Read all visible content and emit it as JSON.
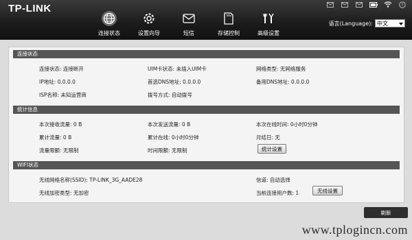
{
  "brand": {
    "logo": "TP-LINK"
  },
  "status_bar_icons": [
    "sms-icon",
    "sms-icon",
    "mail-icon",
    "battery-icon",
    "wifi-icon",
    "help-icon"
  ],
  "nav": {
    "items": [
      {
        "label": "连接状态",
        "icon": "globe-icon",
        "active": true
      },
      {
        "label": "设置向导",
        "icon": "gear-icon",
        "active": false
      },
      {
        "label": "短信",
        "icon": "envelope-icon",
        "active": false
      },
      {
        "label": "存储控制",
        "icon": "sd-card-icon",
        "active": false
      },
      {
        "label": "高级设置",
        "icon": "tools-icon",
        "active": false
      }
    ]
  },
  "language": {
    "label": "语言(Language):",
    "selected": "中文"
  },
  "connection": {
    "header": "连接状态",
    "conn_status": "连接状态: 连接断开",
    "uim_status": "UIM卡状态: 未插入UIM卡",
    "network_type": "网络类型: 无网络服务",
    "ip": "IP地址: 0.0.0.0",
    "dns1": "首选DNS地址: 0.0.0.0",
    "dns2": "备用DNS地址: 0.0.0.0",
    "isp": "ISP名称: 未知运营商",
    "dial_mode": "拨号方式: 自动拨号"
  },
  "stats": {
    "header": "统计信息",
    "rx": "本次接收流量: 0 B",
    "tx": "本次发送流量: 0 B",
    "online_time": "本次在线时间: 0小时0分钟",
    "total_traffic": "累计流量: 0 B",
    "total_online": "累计在线: 0小时0分钟",
    "month_end": "月结日: 无",
    "traffic_limit": "流量限额: 无限制",
    "time_limit": "时间限额: 无限制",
    "stats_button": "统计设置"
  },
  "wifi": {
    "header": "WIFI状态",
    "ssid": "无线网络名称(SSID): TP-LINK_3G_AADE28",
    "channel": "信道: 自动选择",
    "encryption": "无线加密类型: 无加密",
    "users": "当前连接用户数: 1",
    "wifi_button": "无线设置"
  },
  "refresh_label": "刷新",
  "watermark": "www.tplogincn.com"
}
